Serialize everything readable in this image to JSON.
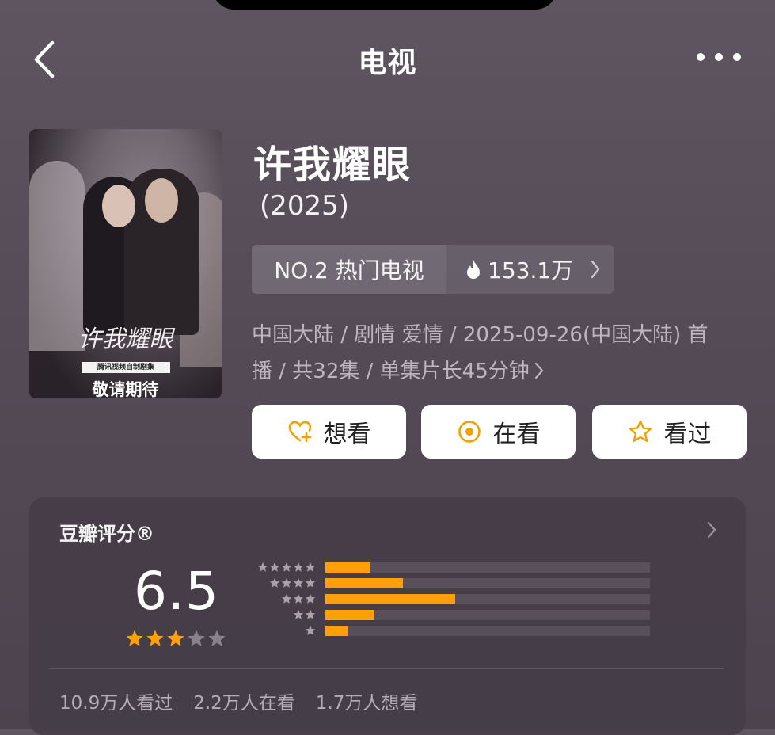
{
  "nav": {
    "title": "电视"
  },
  "poster": {
    "title_art": "许我耀眼",
    "badge": "腾讯视频自制剧集",
    "footer": "敬请期待"
  },
  "show": {
    "title": "许我耀眼",
    "year": "(2025)"
  },
  "rank": {
    "label": "NO.2 热门电视",
    "heat": "153.1万"
  },
  "meta": {
    "line1": "中国大陆 / 剧情 爱情 / 2025-09-26(中国大陆) 首",
    "line2": "播 / 共32集 / 单集片长45分钟"
  },
  "actions": {
    "want": "想看",
    "watching": "在看",
    "watched": "看过"
  },
  "rating": {
    "title": "豆瓣评分®",
    "score": "6.5",
    "stars_filled": 3,
    "stars_total": 5,
    "distribution": [
      {
        "stars": 5,
        "fraction": 0.14
      },
      {
        "stars": 4,
        "fraction": 0.24
      },
      {
        "stars": 3,
        "fraction": 0.4
      },
      {
        "stars": 2,
        "fraction": 0.15
      },
      {
        "stars": 1,
        "fraction": 0.07
      }
    ],
    "counts": {
      "watched": "10.9万人看过",
      "watching": "2.2万人在看",
      "want": "1.7万人想看"
    }
  },
  "colors": {
    "accent": "#ff9f0a",
    "background": "#57505a",
    "card": "#443c46"
  }
}
